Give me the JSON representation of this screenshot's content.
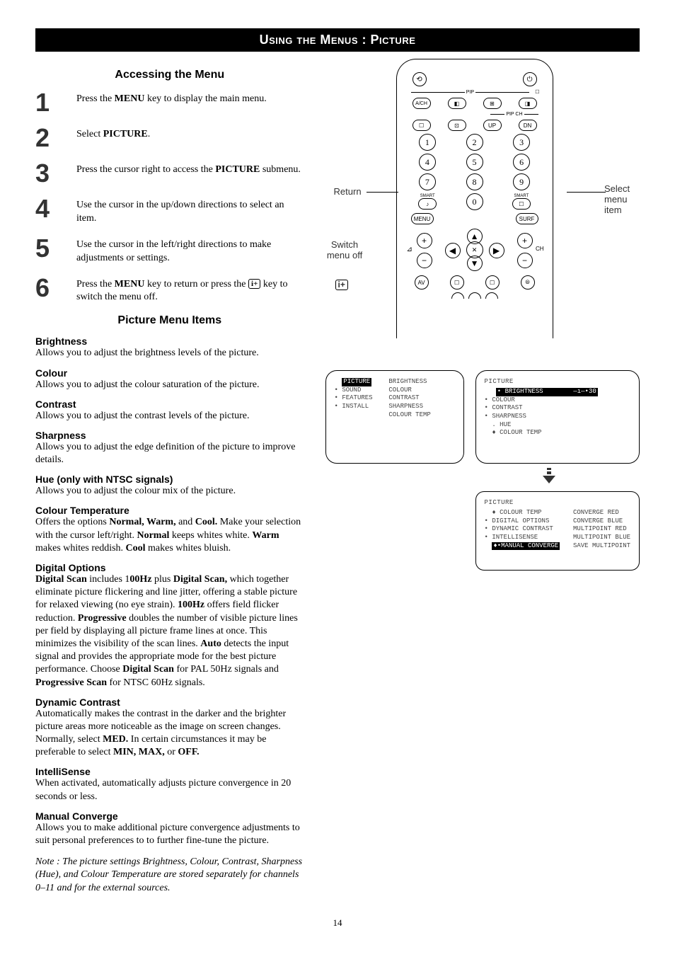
{
  "banner": "Using the Menus : Picture",
  "section_accessing": "Accessing the Menu",
  "steps": [
    {
      "n": "1",
      "html": "Press the <b>MENU</b> key to display the main menu."
    },
    {
      "n": "2",
      "html": "Select <b>PICTURE</b>."
    },
    {
      "n": "3",
      "html": "Press the cursor right to access the <b>PICTURE</b> submenu."
    },
    {
      "n": "4",
      "html": "Use the cursor in the up/down directions to select an item."
    },
    {
      "n": "5",
      "html": "Use the cursor in the left/right directions to make adjustments or settings."
    },
    {
      "n": "6",
      "html": "Press the <b>MENU</b> key to return or press the <span class=\"info-icon\">i+</span> key to switch the menu off."
    }
  ],
  "section_items": "Picture Menu Items",
  "items": [
    {
      "head": "Brightness",
      "body": "Allows you to adjust the brightness levels of the picture."
    },
    {
      "head": "Colour",
      "body": "Allows you to adjust the colour saturation of the picture."
    },
    {
      "head": "Contrast",
      "body": "Allows you to adjust the contrast levels of the picture."
    },
    {
      "head": "Sharpness",
      "body": "Allows you to adjust the edge definition of the picture to improve details."
    },
    {
      "head": "Hue (only with NTSC signals)",
      "body": "Allows you to adjust the colour mix of the picture."
    },
    {
      "head": "Colour Temperature",
      "body": "Offers the options <b>Normal, Warm,</b> and <b>Cool.</b> Make your selection with the cursor left/right. <b>Normal</b> keeps whites white. <b>Warm</b> makes whites reddish. <b>Cool</b> makes whites bluish."
    },
    {
      "head": "Digital Options",
      "body": "<b>Digital Scan</b> includes 1<b>00Hz</b> plus <b>Digital Scan,</b> which together eliminate picture flickering and line jitter, offering a stable picture for relaxed viewing (no eye strain). <b>100Hz</b> offers field flicker reduction. <b>Progressive</b> doubles the number of visible picture lines per field by displaying all picture frame lines at once. This minimizes the visibility of the scan lines. <b>Auto</b> detects the input signal and provides the appropriate mode for the best picture performance. Choose <b>Digital Scan</b> for PAL 50Hz signals and <b>Progressive Scan</b> for NTSC 60Hz signals."
    },
    {
      "head": "Dynamic Contrast",
      "body": "Automatically makes the contrast in the darker and the brighter picture areas more noticeable as the image on screen changes. Normally, select <b>MED.</b> In certain circumstances it may be preferable to select <b>MIN, MAX,</b> or <b>OFF.</b>"
    },
    {
      "head": "IntelliSense",
      "body": "When activated, automatically adjusts picture convergence in 20 seconds or less."
    },
    {
      "head": "Manual Converge",
      "body": "Allows you to make additional picture convergence adjustments to suit personal preferences to to further fine-tune the picture."
    }
  ],
  "note": "Note : The picture settings Brightness, Colour, Contrast, Sharpness (Hue), and Colour Temperature are stored separately for channels 0–11 and for the external sources.",
  "page_number": "14",
  "remote_labels": {
    "return": "Return",
    "select": "Select menu item",
    "switch_off": "Switch menu off",
    "info_icon": "i+"
  },
  "remote_keys": {
    "numbers": [
      "1",
      "2",
      "3",
      "4",
      "5",
      "6",
      "7",
      "8",
      "9",
      "0"
    ],
    "menu": "MENU",
    "surf": "SURF",
    "smart1": "SMART",
    "smart2": "SMART",
    "vol": "⊿",
    "ch": "CH",
    "mute": "🔇",
    "pip": "PIP",
    "pipch": "PIP CH",
    "bottom": [
      "AV",
      "☐",
      "☐",
      "⦾"
    ]
  },
  "osd1": {
    "title_sel": "PICTURE",
    "left": [
      "SOUND",
      "FEATURES",
      "INSTALL"
    ],
    "right": [
      "BRIGHTNESS",
      "COLOUR",
      "CONTRAST",
      "SHARPNESS",
      "COLOUR TEMP"
    ]
  },
  "osd2": {
    "title": "PICTURE",
    "sel_item": "BRIGHTNESS",
    "sel_value": "30",
    "rest": [
      "COLOUR",
      "CONTRAST",
      "SHARPNESS",
      "HUE",
      "COLOUR TEMP"
    ]
  },
  "osd3": {
    "title": "PICTURE",
    "left": [
      "COLOUR TEMP",
      "DIGITAL OPTIONS",
      "DYNAMIC CONTRAST",
      "INTELLISENSE"
    ],
    "left_sel": "MANUAL CONVERGE",
    "right": [
      "CONVERGE RED",
      "CONVERGE BLUE",
      "MULTIPOINT RED",
      "MULTIPOINT BLUE",
      "SAVE MULTIPOINT"
    ]
  }
}
